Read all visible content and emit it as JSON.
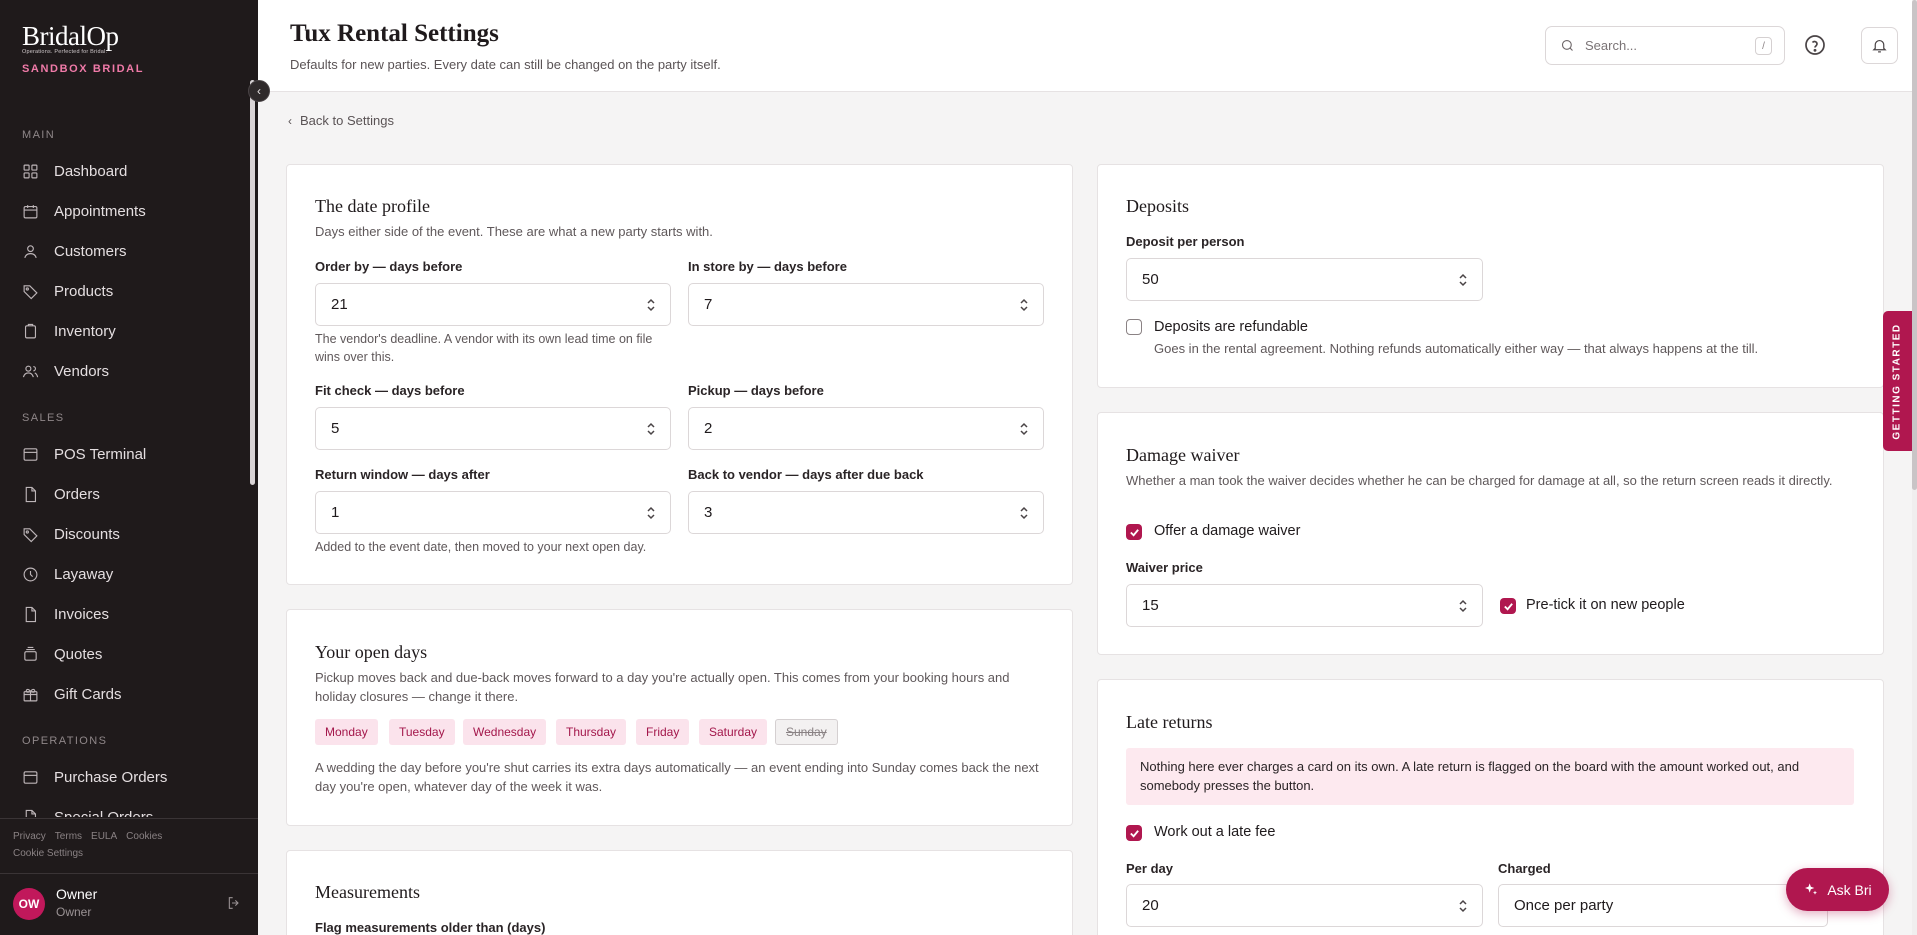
{
  "brand": {
    "logo": "BridalOp",
    "tagline": "Operations. Perfected for Bridal.",
    "store": "SANDBOX BRIDAL"
  },
  "sidebar": {
    "sections": [
      {
        "label": "MAIN"
      },
      {
        "label": "SALES"
      },
      {
        "label": "OPERATIONS"
      }
    ],
    "items": [
      {
        "label": "Dashboard",
        "icon": "grid-icon"
      },
      {
        "label": "Appointments",
        "icon": "calendar-icon"
      },
      {
        "label": "Customers",
        "icon": "user-icon"
      },
      {
        "label": "Products",
        "icon": "tag-icon"
      },
      {
        "label": "Inventory",
        "icon": "clipboard-icon"
      },
      {
        "label": "Vendors",
        "icon": "users-icon"
      },
      {
        "label": "POS Terminal",
        "icon": "terminal-icon"
      },
      {
        "label": "Orders",
        "icon": "file-icon"
      },
      {
        "label": "Discounts",
        "icon": "tag-icon"
      },
      {
        "label": "Layaway",
        "icon": "clock-icon"
      },
      {
        "label": "Invoices",
        "icon": "file-icon"
      },
      {
        "label": "Quotes",
        "icon": "stack-icon"
      },
      {
        "label": "Gift Cards",
        "icon": "gift-icon"
      },
      {
        "label": "Purchase Orders",
        "icon": "terminal-icon"
      },
      {
        "label": "Special Orders",
        "icon": "file-icon"
      }
    ],
    "footer_links": [
      "Privacy",
      "Terms",
      "EULA",
      "Cookies"
    ],
    "cookie_settings": "Cookie Settings",
    "user": {
      "initials": "OW",
      "name": "Owner",
      "role": "Owner"
    }
  },
  "header": {
    "title": "Tux Rental Settings",
    "subtitle": "Defaults for new parties. Every date can still be changed on the party itself.",
    "search_placeholder": "Search...",
    "search_shortcut": "/"
  },
  "back_link": "Back to Settings",
  "date_profile": {
    "title": "The date profile",
    "desc": "Days either side of the event. These are what a new party starts with.",
    "fields": [
      {
        "label": "Order by — days before",
        "value": "21"
      },
      {
        "label": "In store by — days before",
        "value": "7"
      },
      {
        "label": "Fit check — days before",
        "value": "5"
      },
      {
        "label": "Pickup — days before",
        "value": "2"
      },
      {
        "label": "Return window — days after",
        "value": "1"
      },
      {
        "label": "Back to vendor — days after due back",
        "value": "3"
      }
    ],
    "vendor_hint": "The vendor's deadline. A vendor with its own lead time on file wins over this.",
    "return_hint": "Added to the event date, then moved to your next open day."
  },
  "open_days": {
    "title": "Your open days",
    "desc": "Pickup moves back and due-back moves forward to a day you're actually open. This comes from your booking hours and holiday closures — change it there.",
    "days": [
      "Monday",
      "Tuesday",
      "Wednesday",
      "Thursday",
      "Friday",
      "Saturday",
      "Sunday"
    ],
    "closed_day": "Sunday",
    "note": "A wedding the day before you're shut carries its extra days automatically — an event ending into Sunday comes back the next day you're open, whatever day of the week it was."
  },
  "measurements": {
    "title": "Measurements",
    "field_label": "Flag measurements older than (days)"
  },
  "deposits": {
    "title": "Deposits",
    "field_label": "Deposit per person",
    "value": "50",
    "refundable_label": "Deposits are refundable",
    "refundable_checked": false,
    "refundable_hint": "Goes in the rental agreement. Nothing refunds automatically either way — that always happens at the till."
  },
  "damage_waiver": {
    "title": "Damage waiver",
    "desc": "Whether a man took the waiver decides whether he can be charged for damage at all, so the return screen reads it directly.",
    "offer_label": "Offer a damage waiver",
    "offer_checked": true,
    "price_label": "Waiver price",
    "price": "15",
    "pretick_label": "Pre-tick it on new people",
    "pretick_checked": true
  },
  "late_returns": {
    "title": "Late returns",
    "notice": "Nothing here ever charges a card on its own. A late return is flagged on the board with the amount worked out, and somebody presses the button.",
    "fee_label": "Work out a late fee",
    "fee_checked": true,
    "per_day_label": "Per day",
    "per_day": "20",
    "charged_label": "Charged",
    "charged_value": "Once per party"
  },
  "getting_started": "GETTING STARTED",
  "ask_bri": "Ask Bri",
  "colors": {
    "accent": "#b0174f",
    "sidebar_bg": "#1f1a1b",
    "chip_bg": "#fbe3ec",
    "notice_bg": "#fde9ef"
  }
}
